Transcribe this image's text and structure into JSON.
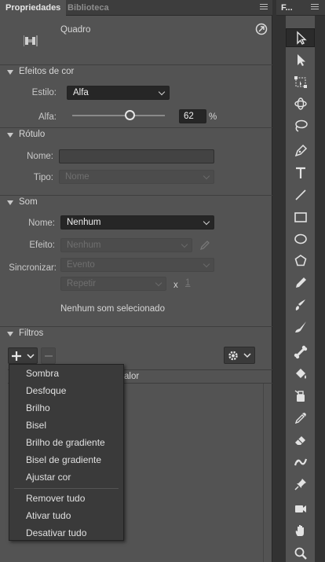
{
  "tabs": [
    {
      "label": "Propriedades"
    },
    {
      "label": "Biblioteca"
    }
  ],
  "tools_panel_title": "F...",
  "instance": {
    "name": "Quadro"
  },
  "color_effects": {
    "title": "Efeitos de cor",
    "style_label": "Estilo:",
    "style_value": "Alfa",
    "alpha_label": "Alfa:",
    "alpha_value": "62",
    "alpha_unit": "%",
    "alpha_fraction": 0.62
  },
  "label_section": {
    "title": "Rótulo",
    "name_label": "Nome:",
    "name_value": "",
    "type_label": "Tipo:",
    "type_value": "Nome"
  },
  "sound": {
    "title": "Som",
    "name_label": "Nome:",
    "name_value": "Nenhum",
    "effect_label": "Efeito:",
    "effect_value": "Nenhum",
    "sync_label": "Sincronizar:",
    "sync_value": "Evento",
    "repeat_value": "Repetir",
    "times_label": "x",
    "times_value": "1",
    "status": "Nenhum som selecionado"
  },
  "filters": {
    "title": "Filtros",
    "value_header": "alor",
    "menu_items": [
      "Sombra",
      "Desfoque",
      "Brilho",
      "Bisel",
      "Brilho de gradiente",
      "Bisel de gradiente",
      "Ajustar cor"
    ],
    "menu_actions": [
      "Remover tudo",
      "Ativar tudo",
      "Desativar tudo"
    ]
  },
  "tools": [
    "selection",
    "subselection",
    "free-transform",
    "3d-rotation",
    "lasso",
    "pen",
    "text",
    "line",
    "rectangle",
    "oval",
    "polystar",
    "pencil",
    "paint-brush",
    "brush",
    "bone",
    "paint-bucket",
    "ink-bottle",
    "eyedropper",
    "eraser",
    "width",
    "pin",
    "camera",
    "hand",
    "zoom"
  ]
}
